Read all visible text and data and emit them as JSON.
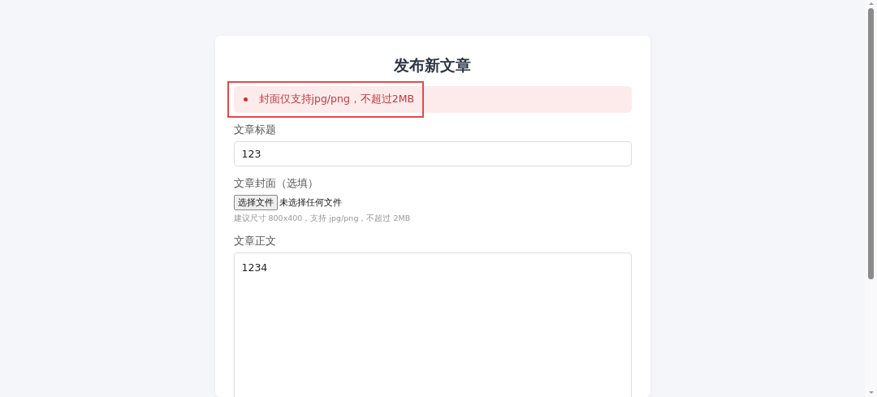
{
  "title": "发布新文章",
  "errors": [
    "封面仅支持jpg/png，不超过2MB"
  ],
  "fields": [
    {
      "kind": "input",
      "label": "文章标题",
      "value": "123"
    },
    {
      "kind": "file",
      "label": "文章封面（选填）",
      "button": "选择文件",
      "status": "未选择任何文件",
      "hint": "建议尺寸 800x400，支持 jpg/png，不超过 2MB"
    },
    {
      "kind": "textarea",
      "label": "文章正文",
      "value": "1234"
    }
  ]
}
